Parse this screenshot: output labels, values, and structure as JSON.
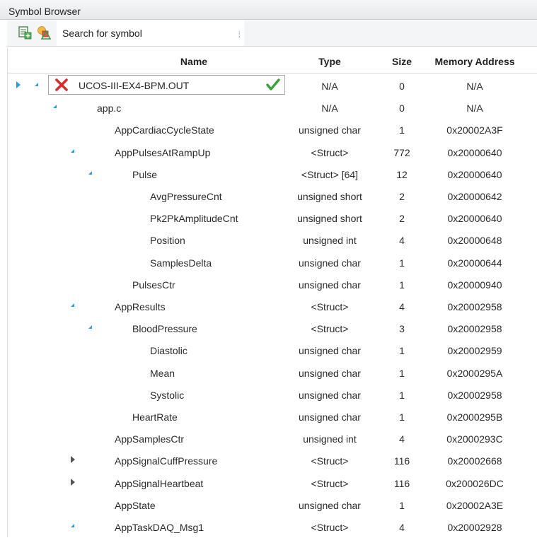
{
  "window": {
    "title": "Symbol Browser"
  },
  "toolbar": {
    "add_icon": "add-watch-icon",
    "shapes_icon": "symbol-shapes-icon",
    "search_placeholder": "Search for symbol"
  },
  "columns": {
    "name": "Name",
    "type": "Type",
    "size": "Size",
    "address": "Memory Address"
  },
  "root": {
    "label": "UCOS-III-EX4-BPM.OUT",
    "type": "N/A",
    "size": "0",
    "address": "N/A"
  },
  "rows": [
    {
      "name": "app.c",
      "type": "N/A",
      "size": "0",
      "address": "N/A",
      "indent": 1,
      "expander": "open"
    },
    {
      "name": "AppCardiacCycleState",
      "type": "unsigned char",
      "size": "1",
      "address": "0x20002A3F",
      "indent": 2,
      "expander": "none"
    },
    {
      "name": "AppPulsesAtRampUp",
      "type": "<Struct>",
      "size": "772",
      "address": "0x20000640",
      "indent": 2,
      "expander": "open"
    },
    {
      "name": "Pulse",
      "type": "<Struct> [64]",
      "size": "12",
      "address": "0x20000640",
      "indent": 3,
      "expander": "open"
    },
    {
      "name": "AvgPressureCnt",
      "type": "unsigned short",
      "size": "2",
      "address": "0x20000642",
      "indent": 4,
      "expander": "none"
    },
    {
      "name": "Pk2PkAmplitudeCnt",
      "type": "unsigned short",
      "size": "2",
      "address": "0x20000640",
      "indent": 4,
      "expander": "none"
    },
    {
      "name": "Position",
      "type": "unsigned int",
      "size": "4",
      "address": "0x20000648",
      "indent": 4,
      "expander": "none"
    },
    {
      "name": "SamplesDelta",
      "type": "unsigned char",
      "size": "1",
      "address": "0x20000644",
      "indent": 4,
      "expander": "none"
    },
    {
      "name": "PulsesCtr",
      "type": "unsigned char",
      "size": "1",
      "address": "0x20000940",
      "indent": 3,
      "expander": "none"
    },
    {
      "name": "AppResults",
      "type": "<Struct>",
      "size": "4",
      "address": "0x20002958",
      "indent": 2,
      "expander": "open"
    },
    {
      "name": "BloodPressure",
      "type": "<Struct>",
      "size": "3",
      "address": "0x20002958",
      "indent": 3,
      "expander": "open"
    },
    {
      "name": "Diastolic",
      "type": "unsigned char",
      "size": "1",
      "address": "0x20002959",
      "indent": 4,
      "expander": "none"
    },
    {
      "name": "Mean",
      "type": "unsigned char",
      "size": "1",
      "address": "0x2000295A",
      "indent": 4,
      "expander": "none"
    },
    {
      "name": "Systolic",
      "type": "unsigned char",
      "size": "1",
      "address": "0x20002958",
      "indent": 4,
      "expander": "none"
    },
    {
      "name": "HeartRate",
      "type": "unsigned char",
      "size": "1",
      "address": "0x2000295B",
      "indent": 3,
      "expander": "none"
    },
    {
      "name": "AppSamplesCtr",
      "type": "unsigned int",
      "size": "4",
      "address": "0x2000293C",
      "indent": 2,
      "expander": "none"
    },
    {
      "name": "AppSignalCuffPressure",
      "type": "<Struct>",
      "size": "116",
      "address": "0x20002668",
      "indent": 2,
      "expander": "closed"
    },
    {
      "name": "AppSignalHeartbeat",
      "type": "<Struct>",
      "size": "116",
      "address": "0x200026DC",
      "indent": 2,
      "expander": "closed"
    },
    {
      "name": "AppState",
      "type": "unsigned char",
      "size": "1",
      "address": "0x20002A3E",
      "indent": 2,
      "expander": "none"
    },
    {
      "name": "AppTaskDAQ_Msg1",
      "type": "<Struct>",
      "size": "4",
      "address": "0x20002928",
      "indent": 2,
      "expander": "open"
    }
  ]
}
